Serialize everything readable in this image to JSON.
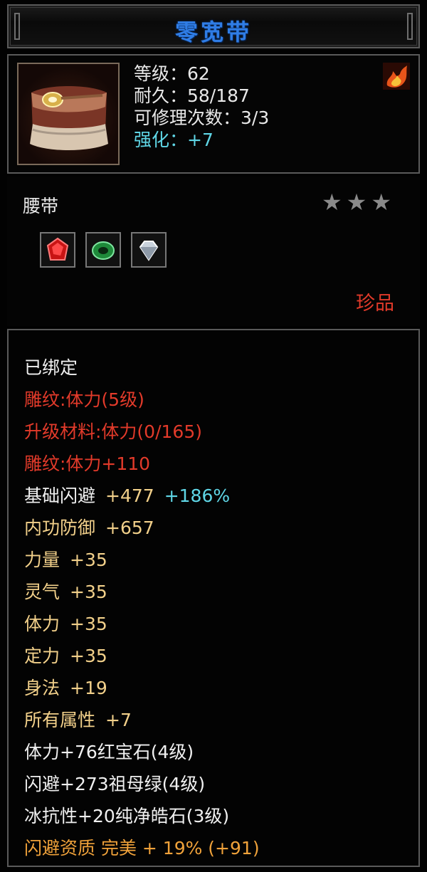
{
  "item": {
    "name": "零宽带",
    "stats": {
      "level": "等级：62",
      "durability": "耐久：58/187",
      "repairs": "可修理次数：3/3",
      "enhance": "强化：+7"
    },
    "type": "腰带",
    "stars_count": 3,
    "rarity": "珍品",
    "gems": [
      {
        "icon": "ruby-gem-icon",
        "color": "#d21a1a"
      },
      {
        "icon": "emerald-ring-icon",
        "color": "#22a24a"
      },
      {
        "icon": "diamond-gem-icon",
        "color": "#cfd6de"
      }
    ]
  },
  "attributes": {
    "bound": "已绑定",
    "engrave_level": "雕纹:体力(5级)",
    "upgrade_material": "升级材料:体力(0/165)",
    "engrave_bonus": "雕纹:体力+110",
    "dodge": {
      "label": "基础闪避",
      "value": "+477",
      "extra": "+186%"
    },
    "inner_defense": {
      "label": "内功防御",
      "value": "+657"
    },
    "strength": {
      "label": "力量",
      "value": "+35"
    },
    "spirit": {
      "label": "灵气",
      "value": "+35"
    },
    "stamina": {
      "label": "体力",
      "value": "+35"
    },
    "focus": {
      "label": "定力",
      "value": "+35"
    },
    "agility": {
      "label": "身法",
      "value": "+19"
    },
    "all_attributes": {
      "label": "所有属性",
      "value": "+7"
    },
    "gem_bonus_1": "体力+76红宝石(4级)",
    "gem_bonus_2": "闪避+273祖母绿(4级)",
    "gem_bonus_3": "冰抗性+20纯净皓石(3级)",
    "quality": "闪避资质 完美 + 19% (+91)"
  },
  "colors": {
    "title": "#2f7de6",
    "red": "#e23a2a",
    "gold": "#f2d08a",
    "cyan": "#5fd6e6",
    "orange": "#f0a23a",
    "star": "#8a8a8a"
  }
}
